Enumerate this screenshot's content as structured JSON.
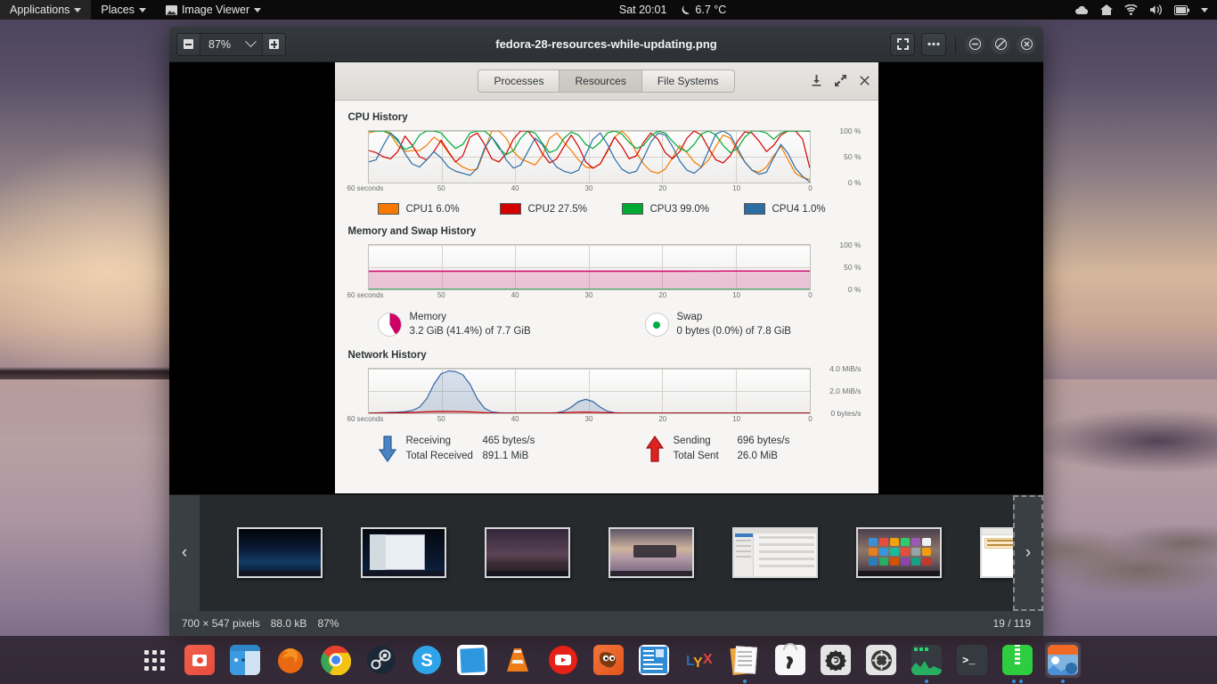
{
  "top_panel": {
    "applications": "Applications",
    "places": "Places",
    "active_app": "Image Viewer",
    "clock": "Sat 20:01",
    "weather": "6.7 °C",
    "weather_icon": "moon-icon",
    "tray": [
      {
        "name": "cloud-icon"
      },
      {
        "name": "home-icon"
      },
      {
        "name": "wifi-icon"
      },
      {
        "name": "volume-icon"
      },
      {
        "name": "battery-icon"
      },
      {
        "name": "chevron-down-icon"
      }
    ]
  },
  "viewer": {
    "title": "fedora-28-resources-while-updating.png",
    "zoom_level": "87%",
    "zoom_out_icon": "zoom-out-icon",
    "zoom_in_icon": "zoom-in-icon",
    "fullscreen_icon": "fullscreen-icon",
    "menu_icon": "overflow-menu-icon",
    "minimize_icon": "minimize-icon",
    "maximize_icon": "maximize-icon",
    "close_icon": "close-icon",
    "prev_label": "‹",
    "next_label": "›"
  },
  "statusbar": {
    "dimensions": "700 × 547 pixels",
    "filesize": "88.0 kB",
    "zoom": "87%",
    "position": "19 / 119"
  },
  "sysmon": {
    "tabs": [
      {
        "label": "Processes",
        "active": false
      },
      {
        "label": "Resources",
        "active": true
      },
      {
        "label": "File Systems",
        "active": false
      }
    ],
    "window_buttons": [
      {
        "name": "download-icon",
        "glyph": "⬇"
      },
      {
        "name": "expand-icon",
        "glyph": "⤡"
      },
      {
        "name": "close-icon",
        "glyph": "✕"
      }
    ],
    "cpu": {
      "title": "CPU History",
      "legend": [
        {
          "label": "CPU1 6.0%",
          "color": "#f57900"
        },
        {
          "label": "CPU2 27.5%",
          "color": "#d40000"
        },
        {
          "label": "CPU3 99.0%",
          "color": "#00a933"
        },
        {
          "label": "CPU4 1.0%",
          "color": "#2e6da4"
        }
      ]
    },
    "memory": {
      "title": "Memory and Swap History",
      "memory_label": "Memory",
      "memory_value": "3.2 GiB (41.4%) of 7.7 GiB",
      "memory_color": "#cc0066",
      "swap_label": "Swap",
      "swap_value": "0 bytes (0.0%) of 7.8 GiB",
      "swap_color": "#00aa44"
    },
    "network": {
      "title": "Network History",
      "receiving_label": "Receiving",
      "receiving_value": "465 bytes/s",
      "total_received_label": "Total Received",
      "total_received_value": "891.1 MiB",
      "sending_label": "Sending",
      "sending_value": "696 bytes/s",
      "total_sent_label": "Total Sent",
      "total_sent_value": "26.0 MiB",
      "receiving_icon": "down-arrow-icon",
      "sending_icon": "up-arrow-icon"
    }
  },
  "chart_data": [
    {
      "type": "line",
      "title": "CPU History",
      "xlabel": "",
      "ylabel": "",
      "x_ticks": [
        "60 seconds",
        "50",
        "40",
        "30",
        "20",
        "10",
        "0"
      ],
      "y_ticks": [
        "100 %",
        "50 %",
        "0 %"
      ],
      "ylim": [
        0,
        100
      ],
      "grid": true,
      "legend_position": "below",
      "series": [
        {
          "name": "CPU1",
          "color": "#f57900",
          "current": 6.0,
          "values": [
            96,
            100,
            100,
            93,
            72,
            60,
            62,
            62,
            72,
            88,
            78,
            58,
            40,
            30,
            24,
            26,
            62,
            100,
            100,
            86,
            60,
            46,
            40,
            34,
            52,
            86,
            96,
            78,
            62,
            44,
            30,
            28,
            36,
            60,
            88,
            100,
            86,
            58,
            36,
            22,
            18,
            26,
            48,
            72,
            58,
            40,
            30,
            44,
            70,
            92,
            86,
            60,
            40,
            24,
            20,
            30,
            52,
            70,
            44,
            18,
            10,
            6
          ]
        },
        {
          "name": "CPU2",
          "color": "#d40000",
          "current": 27.5,
          "values": [
            62,
            58,
            50,
            46,
            60,
            90,
            72,
            50,
            44,
            60,
            82,
            60,
            40,
            52,
            88,
            96,
            74,
            46,
            40,
            56,
            84,
            100,
            100,
            82,
            56,
            38,
            46,
            70,
            92,
            70,
            40,
            28,
            36,
            62,
            88,
            70,
            46,
            52,
            78,
            96,
            84,
            58,
            46,
            60,
            86,
            100,
            92,
            66,
            44,
            38,
            52,
            80,
            98,
            96,
            80,
            60,
            72,
            92,
            100,
            100,
            84,
            28
          ]
        },
        {
          "name": "CPU3",
          "color": "#00a933",
          "current": 99.0,
          "values": [
            100,
            100,
            100,
            96,
            80,
            64,
            70,
            92,
            100,
            100,
            96,
            80,
            66,
            74,
            96,
            100,
            100,
            88,
            66,
            54,
            62,
            86,
            100,
            96,
            76,
            58,
            64,
            86,
            98,
            92,
            74,
            66,
            78,
            96,
            100,
            94,
            78,
            66,
            72,
            90,
            100,
            96,
            80,
            66,
            60,
            74,
            94,
            100,
            92,
            72,
            58,
            66,
            88,
            100,
            100,
            96,
            84,
            96,
            100,
            100,
            100,
            99
          ]
        },
        {
          "name": "CPU4",
          "color": "#2e6da4",
          "current": 1.0,
          "values": [
            40,
            44,
            72,
            96,
            84,
            56,
            36,
            30,
            44,
            60,
            48,
            30,
            22,
            18,
            14,
            28,
            66,
            88,
            70,
            44,
            28,
            34,
            60,
            86,
            74,
            48,
            30,
            22,
            18,
            24,
            54,
            84,
            96,
            74,
            46,
            26,
            18,
            22,
            48,
            78,
            96,
            92,
            70,
            42,
            24,
            18,
            30,
            62,
            94,
            100,
            92,
            66,
            40,
            24,
            16,
            20,
            48,
            74,
            56,
            28,
            12,
            1
          ]
        }
      ]
    },
    {
      "type": "line",
      "title": "Memory and Swap History",
      "x_ticks": [
        "60 seconds",
        "50",
        "40",
        "30",
        "20",
        "10",
        "0"
      ],
      "y_ticks": [
        "100 %",
        "50 %",
        "0 %"
      ],
      "ylim": [
        0,
        100
      ],
      "grid": true,
      "series": [
        {
          "name": "Memory",
          "color": "#cc0066",
          "current": 41.4,
          "values": [
            41.0,
            41.0,
            41.0,
            41.0,
            41.0,
            41.0,
            41.0,
            41.0,
            41.0,
            41.0,
            41.0,
            41.0,
            41.0,
            41.0,
            41.0,
            41.0,
            41.0,
            41.0,
            41.0,
            41.0,
            41.0,
            41.0,
            41.0,
            41.0,
            41.0,
            41.0,
            41.0,
            41.0,
            41.0,
            41.0,
            41.0,
            41.0,
            41.0,
            41.0,
            41.0,
            41.0,
            41.0,
            41.0,
            41.0,
            41.0,
            41.0,
            41.0,
            41.0,
            41.0,
            41.0,
            41.2,
            41.2,
            41.2,
            41.2,
            41.3,
            41.3,
            41.3,
            41.4,
            41.4,
            41.4,
            41.4,
            41.4,
            41.4,
            41.4,
            41.4,
            41.4,
            41.4
          ]
        },
        {
          "name": "Swap",
          "color": "#00aa44",
          "current": 0.0,
          "values": [
            0,
            0,
            0,
            0,
            0,
            0,
            0,
            0,
            0,
            0,
            0,
            0,
            0,
            0,
            0,
            0,
            0,
            0,
            0,
            0,
            0,
            0,
            0,
            0,
            0,
            0,
            0,
            0,
            0,
            0,
            0,
            0,
            0,
            0,
            0,
            0,
            0,
            0,
            0,
            0,
            0,
            0,
            0,
            0,
            0,
            0,
            0,
            0,
            0,
            0,
            0,
            0,
            0,
            0,
            0,
            0,
            0,
            0,
            0,
            0,
            0,
            0
          ]
        }
      ]
    },
    {
      "type": "line",
      "title": "Network History",
      "x_ticks": [
        "60 seconds",
        "50",
        "40",
        "30",
        "20",
        "10",
        "0"
      ],
      "y_ticks": [
        "4.0 MiB/s",
        "2.0 MiB/s",
        "0 bytes/s"
      ],
      "ylim": [
        0,
        4.0
      ],
      "grid": true,
      "series": [
        {
          "name": "Receiving",
          "color": "#3465a4",
          "current": 465,
          "values": [
            0.02,
            0.03,
            0.05,
            0.08,
            0.1,
            0.14,
            0.25,
            0.55,
            1.3,
            2.6,
            3.55,
            3.8,
            3.75,
            3.45,
            2.6,
            1.3,
            0.45,
            0.12,
            0.05,
            0.03,
            0.02,
            0.02,
            0.02,
            0.02,
            0.02,
            0.02,
            0.05,
            0.18,
            0.55,
            1.05,
            1.25,
            1.05,
            0.55,
            0.18,
            0.05,
            0.02,
            0.02,
            0.02,
            0.02,
            0.02,
            0.02,
            0.02,
            0.02,
            0.02,
            0.02,
            0.02,
            0.02,
            0.02,
            0.02,
            0.02,
            0.02,
            0.02,
            0.02,
            0.02,
            0.02,
            0.02,
            0.02,
            0.02,
            0.02,
            0.02,
            0.02,
            0.02
          ]
        },
        {
          "name": "Sending",
          "color": "#cc0000",
          "current": 696,
          "values": [
            0.01,
            0.01,
            0.02,
            0.03,
            0.04,
            0.05,
            0.07,
            0.1,
            0.13,
            0.15,
            0.16,
            0.16,
            0.15,
            0.14,
            0.12,
            0.09,
            0.05,
            0.02,
            0.01,
            0.01,
            0.01,
            0.01,
            0.01,
            0.01,
            0.01,
            0.01,
            0.02,
            0.04,
            0.07,
            0.09,
            0.1,
            0.09,
            0.07,
            0.04,
            0.02,
            0.01,
            0.01,
            0.01,
            0.01,
            0.01,
            0.01,
            0.01,
            0.01,
            0.01,
            0.01,
            0.01,
            0.01,
            0.01,
            0.01,
            0.01,
            0.01,
            0.01,
            0.01,
            0.01,
            0.01,
            0.01,
            0.01,
            0.01,
            0.01,
            0.01,
            0.01,
            0.01
          ]
        }
      ]
    }
  ],
  "thumbnails": [
    {
      "name": "thumb-1",
      "selected": false
    },
    {
      "name": "thumb-2",
      "selected": false
    },
    {
      "name": "thumb-3",
      "selected": false
    },
    {
      "name": "thumb-4",
      "selected": false
    },
    {
      "name": "thumb-5",
      "selected": false
    },
    {
      "name": "thumb-6",
      "selected": false
    },
    {
      "name": "thumb-7",
      "selected": false
    },
    {
      "name": "thumb-8",
      "selected": true
    }
  ],
  "dock": [
    {
      "name": "app-grid-icon"
    },
    {
      "name": "screenshot-icon"
    },
    {
      "name": "files-icon"
    },
    {
      "name": "firefox-icon"
    },
    {
      "name": "chrome-icon"
    },
    {
      "name": "steam-icon"
    },
    {
      "name": "skype-icon"
    },
    {
      "name": "mail-icon"
    },
    {
      "name": "vlc-icon"
    },
    {
      "name": "youtube-icon"
    },
    {
      "name": "gimp-icon"
    },
    {
      "name": "ebook-icon"
    },
    {
      "name": "lyx-icon"
    },
    {
      "name": "documents-icon"
    },
    {
      "name": "software-icon"
    },
    {
      "name": "tweaks-icon"
    },
    {
      "name": "settings-icon"
    },
    {
      "name": "system-monitor-icon"
    },
    {
      "name": "terminal-icon"
    },
    {
      "name": "archive-manager-icon"
    },
    {
      "name": "image-viewer-icon"
    }
  ]
}
